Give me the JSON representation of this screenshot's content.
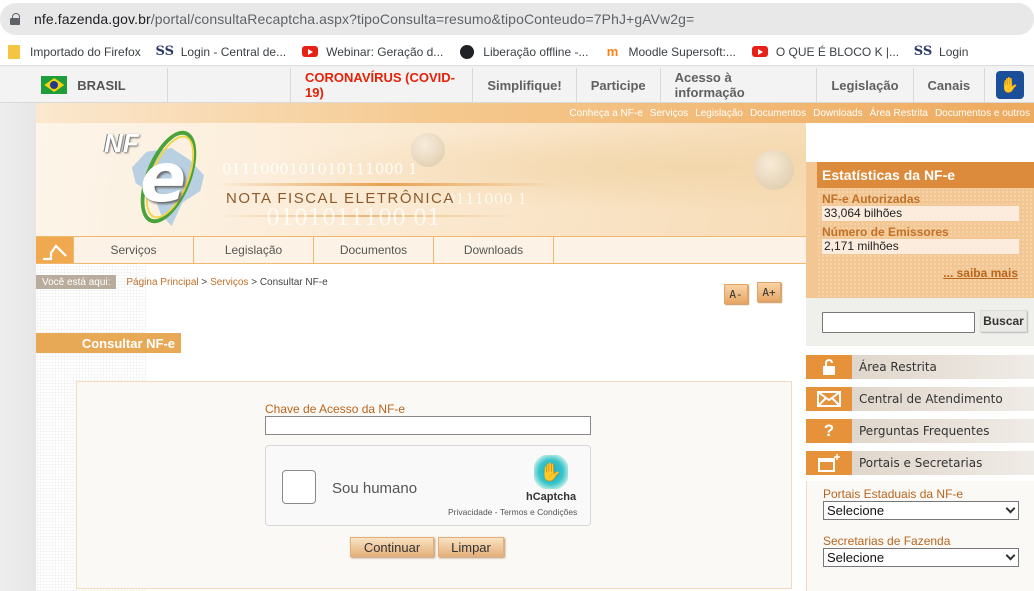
{
  "browser": {
    "url_host": "nfe.fazenda.gov.br",
    "url_rest": "/portal/consultaRecaptcha.aspx?tipoConsulta=resumo&tipoConteudo=7PhJ+gAVw2g=",
    "bookmarks": [
      {
        "label": "Importado do Firefox",
        "icon": "folder-icon"
      },
      {
        "label": "Login - Central de...",
        "icon": "supersoft-icon"
      },
      {
        "label": "Webinar: Geração d...",
        "icon": "youtube-icon"
      },
      {
        "label": "Liberação offline -...",
        "icon": "globe-icon"
      },
      {
        "label": "Moodle Supersoft:...",
        "icon": "moodle-icon"
      },
      {
        "label": "O QUE É BLOCO K |...",
        "icon": "youtube-icon"
      },
      {
        "label": "Login",
        "icon": "supersoft-icon"
      }
    ]
  },
  "govbar": {
    "brasil": "BRASIL",
    "items": [
      "CORONAVÍRUS (COVID-19)",
      "Simplifique!",
      "Participe",
      "Acesso à informação",
      "Legislação",
      "Canais"
    ],
    "covid_color": "#e52207"
  },
  "toplinks": [
    "Conheça a NF-e",
    "Serviços",
    "Legislação",
    "Documentos",
    "Downloads",
    "Área Restrita",
    "Documentos e outros"
  ],
  "banner": {
    "logo_text": "NF",
    "logo_e": "e",
    "title": "NOTA FISCAL ELETRÔNICA",
    "binary1": "0111000101010111000 1",
    "binary2": "0101011100 01",
    "binary3": "0111000 1"
  },
  "mainnav": [
    "Serviços",
    "Legislação",
    "Documentos",
    "Downloads"
  ],
  "breadcrumb": {
    "label": "Você está aqui:",
    "items": [
      "Página Principal",
      "Serviços",
      "Consultar NF-e"
    ],
    "separator": " > "
  },
  "font_controls": {
    "decrease": "A-",
    "increase": "A+"
  },
  "section_title": "Consultar NF-e",
  "form": {
    "key_label": "Chave de Acesso da NF-e",
    "key_value": "",
    "captcha": {
      "label": "Sou humano",
      "brand": "hCaptcha",
      "links": "Privacidade - Termos e Condições",
      "checked": false
    },
    "continue": "Continuar",
    "clear": "Limpar"
  },
  "stats": {
    "title": "Estatísticas da NF-e",
    "authorized_label": "NF-e Autorizadas",
    "authorized_value": "33,064 bilhões",
    "issuers_label": "Número de Emissores",
    "issuers_value": "2,171 milhões",
    "more": "... saiba mais"
  },
  "search": {
    "value": "",
    "button": "Buscar"
  },
  "side_links": [
    {
      "label": "Área Restrita",
      "icon": "lock-icon"
    },
    {
      "label": "Central de Atendimento",
      "icon": "envelope-icon"
    },
    {
      "label": "Perguntas Frequentes",
      "icon": "question-icon"
    },
    {
      "label": "Portais e Secretarias",
      "icon": "window-add-icon"
    }
  ],
  "portals": {
    "state_label": "Portais Estaduais da NF-e",
    "state_selected": "Selecione",
    "secretaria_label": "Secretarias de Fazenda",
    "secretaria_selected": "Selecione"
  }
}
